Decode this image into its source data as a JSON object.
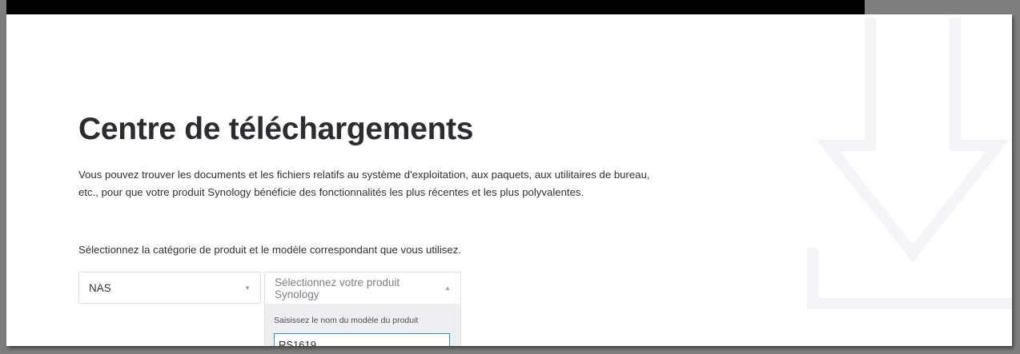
{
  "header": {
    "title": "Centre de téléchargements",
    "description_lines": [
      "Vous pouvez trouver les documents et les fichiers relatifs au système d'exploitation, aux paquets, aux utilitaires de bureau,",
      "etc., pour que votre produit Synology bénéficie des fonctionnalités les plus récentes et les plus polyvalentes."
    ]
  },
  "selection": {
    "instruction": "Sélectionnez la catégorie de produit et le modèle correspondant que vous utilisez.",
    "category": {
      "value": "NAS",
      "arrow": "▼"
    },
    "product": {
      "placeholder": "Sélectionnez votre produit Synology",
      "arrow": "▲",
      "dropdown": {
        "search_label": "Saisissez le nom du modèle du produit",
        "search_value": "RS1619"
      }
    }
  },
  "icons": {
    "watermark": "download-arrow-icon"
  },
  "colors": {
    "title": "#2b2d33",
    "input_focus": "#3a8bd1",
    "dropdown_bg": "#eceef1",
    "watermark": "#f3f5f8"
  }
}
